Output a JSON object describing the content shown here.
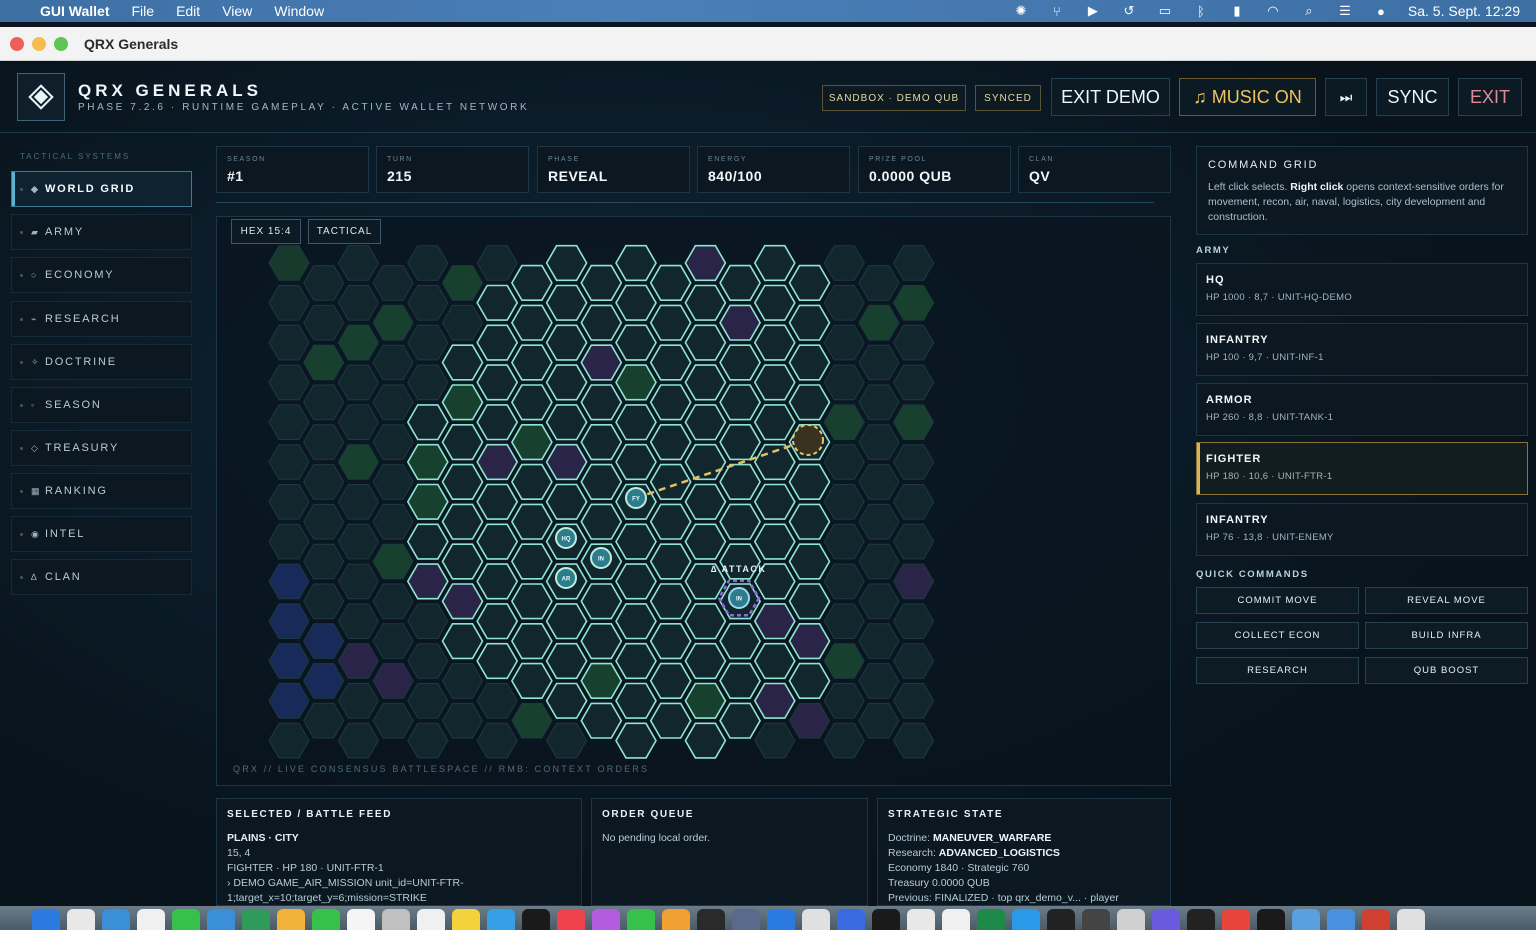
{
  "menubar": {
    "app_name": "GUI Wallet",
    "items": [
      "File",
      "Edit",
      "View",
      "Window"
    ],
    "clock": "Sa. 5. Sept.  12:29"
  },
  "window": {
    "title": "QRX Generals"
  },
  "header": {
    "title": "QRX GENERALS",
    "subtitle": "PHASE 7.2.6 · RUNTIME GAMEPLAY · ACTIVE WALLET NETWORK",
    "badge_sandbox": "SANDBOX · DEMO QUB",
    "badge_synced": "SYNCED",
    "exit_demo": "EXIT DEMO",
    "music": "♫ MUSIC ON",
    "skip": "⏭",
    "sync": "SYNC",
    "exit": "EXIT"
  },
  "sidebar": {
    "label": "TACTICAL SYSTEMS",
    "items": [
      {
        "label": "WORLD GRID",
        "icon": "◆"
      },
      {
        "label": "ARMY",
        "icon": "▰"
      },
      {
        "label": "ECONOMY",
        "icon": "○"
      },
      {
        "label": "RESEARCH",
        "icon": "⌁"
      },
      {
        "label": "DOCTRINE",
        "icon": "✧"
      },
      {
        "label": "SEASON",
        "icon": "◦"
      },
      {
        "label": "TREASURY",
        "icon": "◇"
      },
      {
        "label": "RANKING",
        "icon": "▦"
      },
      {
        "label": "INTEL",
        "icon": "◉"
      },
      {
        "label": "CLAN",
        "icon": "∆"
      }
    ]
  },
  "stats": [
    {
      "label": "SEASON",
      "value": "#1"
    },
    {
      "label": "TURN",
      "value": "215"
    },
    {
      "label": "PHASE",
      "value": "REVEAL"
    },
    {
      "label": "ENERGY",
      "value": "840/100"
    },
    {
      "label": "PRIZE POOL",
      "value": "0.0000 QUB"
    },
    {
      "label": "CLAN",
      "value": "QV"
    }
  ],
  "map": {
    "tag_hex": "HEX 15:4",
    "tag_mode": "TACTICAL",
    "caption": "QRX // LIVE CONSENSUS BATTLESPACE // RMB: CONTEXT ORDERS",
    "attack_label": "∆ ATTACK",
    "units": {
      "hq": "HQ",
      "in": "IN",
      "ar": "AR",
      "fy": "FY",
      "enemy": "IN"
    }
  },
  "battle_feed": {
    "title": "SELECTED / BATTLE FEED",
    "terrain": "PLAINS · CITY",
    "coords": "15, 4",
    "unit": "FIGHTER · HP 180 · UNIT-FTR-1",
    "log1": "› DEMO GAME_AIR_MISSION unit_id=UNIT-FTR-",
    "log2": "1;target_x=10;target_y=6;mission=STRIKE"
  },
  "order_queue": {
    "title": "ORDER QUEUE",
    "text": "No pending local order."
  },
  "strategic": {
    "title": "STRATEGIC STATE",
    "doctrine_label": "Doctrine: ",
    "doctrine": "MANEUVER_WARFARE",
    "research_label": "Research: ",
    "research": "ADVANCED_LOGISTICS",
    "economy": "Economy 1840 · Strategic 760",
    "treasury": "Treasury 0.0000 QUB",
    "previous": "Previous: FINALIZED · top qrx_demo_v... · player"
  },
  "command_grid": {
    "title": "COMMAND GRID",
    "text_a": "Left click selects. ",
    "text_b": "Right click",
    "text_c": " opens context-sensitive orders for movement, recon, air, naval, logistics, city development and construction."
  },
  "army": {
    "title": "ARMY",
    "units": [
      {
        "name": "HQ",
        "detail": "HP 1000 · 8,7 · UNIT-HQ-DEMO"
      },
      {
        "name": "INFANTRY",
        "detail": "HP 100 · 9,7 · UNIT-INF-1"
      },
      {
        "name": "ARMOR",
        "detail": "HP 260 · 8,8 · UNIT-TANK-1"
      },
      {
        "name": "FIGHTER",
        "detail": "HP 180 · 10,6 · UNIT-FTR-1"
      },
      {
        "name": "INFANTRY",
        "detail": "HP 76 · 13,8 · UNIT-ENEMY"
      }
    ]
  },
  "quick": {
    "title": "QUICK COMMANDS",
    "commands": [
      "COMMIT MOVE",
      "REVEAL MOVE",
      "COLLECT ECON",
      "BUILD INFRA",
      "RESEARCH",
      "QUB BOOST"
    ]
  },
  "colors": {
    "accent": "#5ab3d0",
    "gold": "#d8b35a",
    "hex_outline_active": "#7fe0c0",
    "enemy": "#8a6ad8"
  }
}
